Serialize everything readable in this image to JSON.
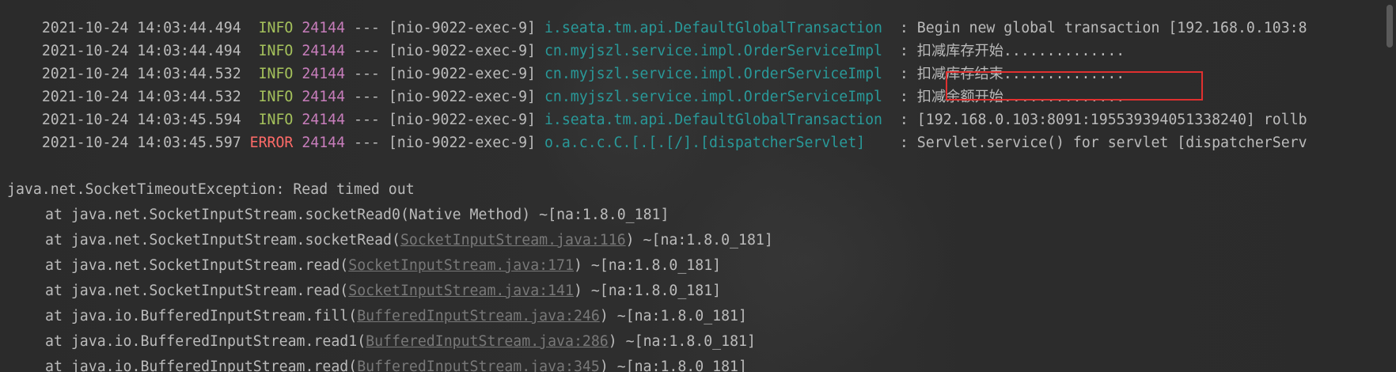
{
  "log_lines": [
    {
      "time": "2021-10-24 14:03:44.494",
      "level": " INFO",
      "pid": "24144",
      "sep": "---",
      "thread": "[nio-9022-exec-9]",
      "logger": "i.seata.tm.api.DefaultGlobalTransaction ",
      "message": ": Begin new global transaction [192.168.0.103:8"
    },
    {
      "time": "2021-10-24 14:03:44.494",
      "level": " INFO",
      "pid": "24144",
      "sep": "---",
      "thread": "[nio-9022-exec-9]",
      "logger": "cn.myjszl.service.impl.OrderServiceImpl ",
      "message": ": 扣减库存开始.............."
    },
    {
      "time": "2021-10-24 14:03:44.532",
      "level": " INFO",
      "pid": "24144",
      "sep": "---",
      "thread": "[nio-9022-exec-9]",
      "logger": "cn.myjszl.service.impl.OrderServiceImpl ",
      "message": ": 扣减库存结束.............."
    },
    {
      "time": "2021-10-24 14:03:44.532",
      "level": " INFO",
      "pid": "24144",
      "sep": "---",
      "thread": "[nio-9022-exec-9]",
      "logger": "cn.myjszl.service.impl.OrderServiceImpl ",
      "message": ": 扣减余额开始.............."
    },
    {
      "time": "2021-10-24 14:03:45.594",
      "level": " INFO",
      "pid": "24144",
      "sep": "---",
      "thread": "[nio-9022-exec-9]",
      "logger": "i.seata.tm.api.DefaultGlobalTransaction ",
      "message": ": [192.168.0.103:8091:195539394051338240] rollb"
    },
    {
      "time": "2021-10-24 14:03:45.597",
      "level": "ERROR",
      "pid": "24144",
      "sep": "---",
      "thread": "[nio-9022-exec-9]",
      "logger": "o.a.c.c.C.[.[.[/].[dispatcherServlet]   ",
      "message": ": Servlet.service() for servlet [dispatcherServ"
    }
  ],
  "exception": {
    "header": "java.net.SocketTimeoutException: Read timed out",
    "frames": [
      {
        "prefix": "at java.net.SocketInputStream.socketRead0(",
        "link": "",
        "plain": "Native Method",
        "suffix": ") ~[na:1.8.0_181]"
      },
      {
        "prefix": "at java.net.SocketInputStream.socketRead(",
        "link": "SocketInputStream.java:116",
        "plain": "",
        "suffix": ") ~[na:1.8.0_181]"
      },
      {
        "prefix": "at java.net.SocketInputStream.read(",
        "link": "SocketInputStream.java:171",
        "plain": "",
        "suffix": ") ~[na:1.8.0_181]"
      },
      {
        "prefix": "at java.net.SocketInputStream.read(",
        "link": "SocketInputStream.java:141",
        "plain": "",
        "suffix": ") ~[na:1.8.0_181]"
      },
      {
        "prefix": "at java.io.BufferedInputStream.fill(",
        "link": "BufferedInputStream.java:246",
        "plain": "",
        "suffix": ") ~[na:1.8.0_181]"
      },
      {
        "prefix": "at java.io.BufferedInputStream.read1(",
        "link": "BufferedInputStream.java:286",
        "plain": "",
        "suffix": ") ~[na:1.8.0_181]"
      },
      {
        "prefix": "at java.io.BufferedInputStream.read(",
        "link": "BufferedInputStream.java:345",
        "plain": "",
        "suffix": ") ~[na:1.8.0_181]"
      }
    ]
  },
  "colors": {
    "background": "#2b2b2b",
    "text": "#bbbbbb",
    "info": "#a5c25c",
    "error": "#ff6b68",
    "pid": "#c77dbb",
    "logger": "#299999",
    "link": "#787878",
    "highlight_box": "#e0302f"
  }
}
